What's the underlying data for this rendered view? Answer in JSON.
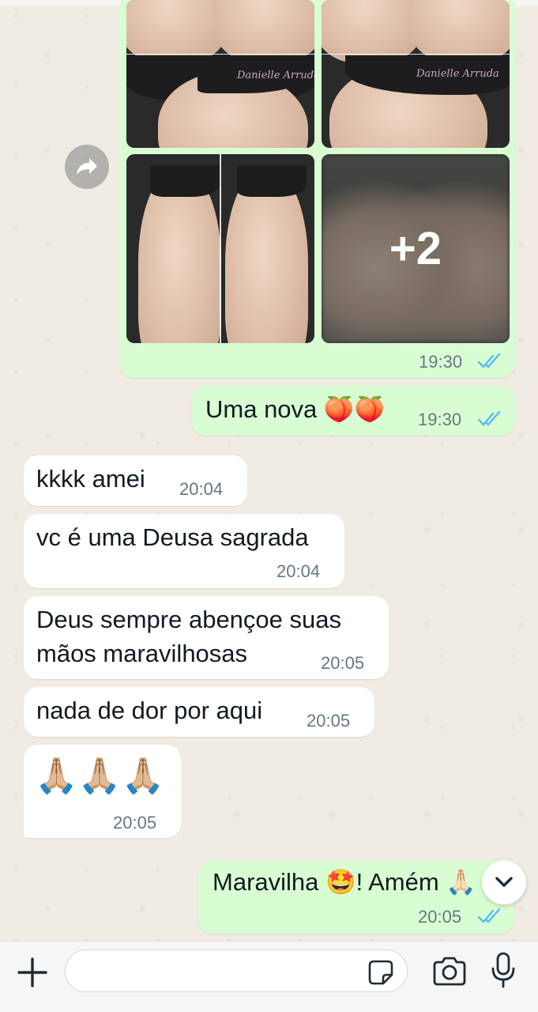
{
  "colors": {
    "outgoing_bubble": "#d9fdd3",
    "incoming_bubble": "#ffffff",
    "read_ticks": "#53bdeb",
    "timestamp": "#667781"
  },
  "media_message": {
    "extra_count_label": "+2",
    "time": "19:30",
    "photo_brand_text": "Danielle Arruda"
  },
  "messages": [
    {
      "direction": "out",
      "text": "Uma nova 🍑🍑",
      "time": "19:30"
    },
    {
      "direction": "in",
      "text": "kkkk amei",
      "time": "20:04"
    },
    {
      "direction": "in",
      "text": "vc é uma Deusa sagrada",
      "time": "20:04"
    },
    {
      "direction": "in",
      "text": "Deus sempre abençoe suas\nmãos maravilhosas",
      "time": "20:05"
    },
    {
      "direction": "in",
      "text": "nada de dor por aqui",
      "time": "20:05"
    },
    {
      "direction": "in",
      "text": "🙏🏼🙏🏼🙏🏼",
      "time": "20:05"
    },
    {
      "direction": "out",
      "text": "Maravilha 🤩! Amém 🙏🏻",
      "time": "20:05"
    }
  ],
  "icons": {
    "forward": "forward-arrow-icon",
    "scroll_down": "chevron-down-icon",
    "attach": "plus-icon",
    "sticker": "sticker-icon",
    "camera": "camera-icon",
    "mic": "microphone-icon",
    "read_receipt": "double-check-icon"
  },
  "composer": {
    "value": "",
    "placeholder": ""
  }
}
